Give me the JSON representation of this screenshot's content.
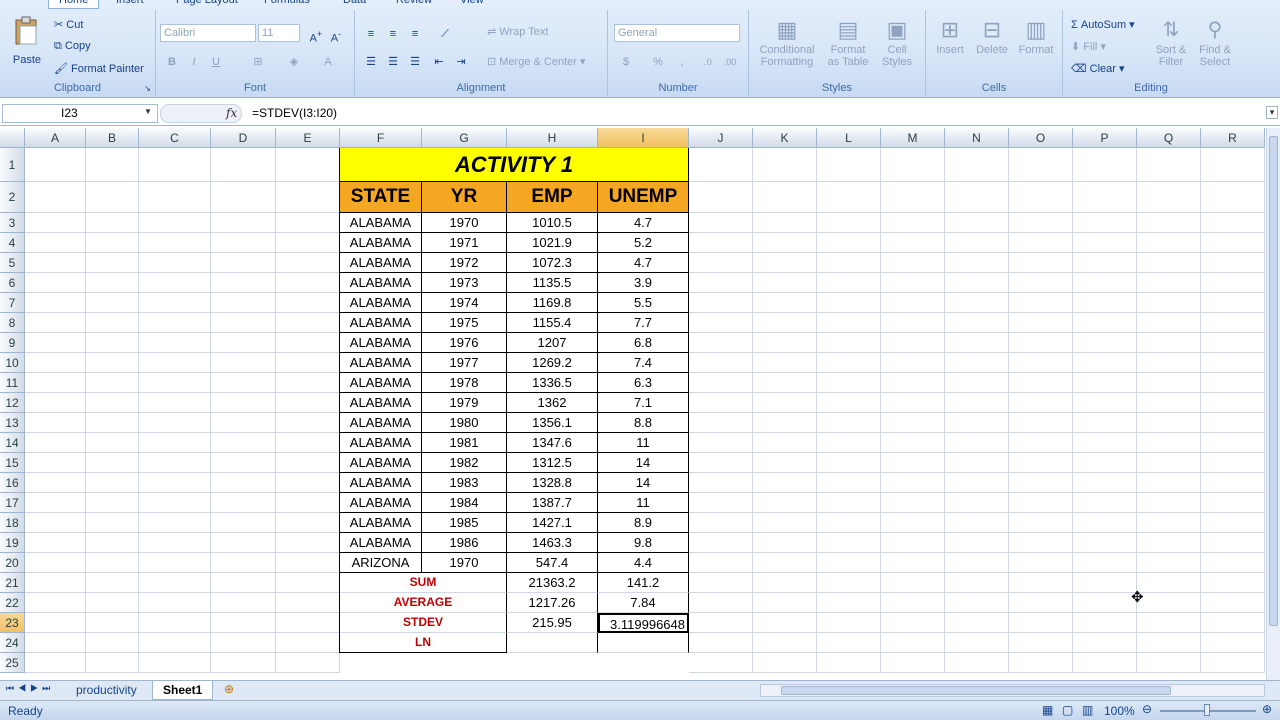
{
  "ribbon": {
    "tabs": [
      "Home",
      "Insert",
      "Page Layout",
      "Formulas",
      "Data",
      "Review",
      "View"
    ],
    "clipboard": {
      "label": "Clipboard",
      "paste": "Paste",
      "cut": "Cut",
      "copy": "Copy",
      "format_painter": "Format Painter"
    },
    "font": {
      "label": "Font",
      "font_name": "Calibri",
      "font_size": "11"
    },
    "alignment": {
      "label": "Alignment",
      "wrap_text": "Wrap Text",
      "merge_center": "Merge & Center"
    },
    "number": {
      "label": "Number",
      "format": "General"
    },
    "styles": {
      "label": "Styles",
      "conditional_1": "Conditional",
      "conditional_2": "Formatting",
      "format_table_1": "Format",
      "format_table_2": "as Table",
      "cell_styles_1": "Cell",
      "cell_styles_2": "Styles"
    },
    "cells": {
      "label": "Cells",
      "insert": "Insert",
      "delete": "Delete",
      "format": "Format"
    },
    "editing": {
      "label": "Editing",
      "autosum": "AutoSum",
      "fill": "Fill",
      "clear": "Clear",
      "sort_1": "Sort &",
      "sort_2": "Filter",
      "find_1": "Find &",
      "find_2": "Select"
    }
  },
  "formula_bar": {
    "name_box": "I23",
    "fx": "fx",
    "formula": "=STDEV(I3:I20)"
  },
  "columns": [
    "A",
    "B",
    "C",
    "D",
    "E",
    "F",
    "G",
    "H",
    "I",
    "J",
    "K",
    "L",
    "M",
    "N",
    "O",
    "P",
    "Q",
    "R"
  ],
  "rows": [
    "1",
    "2",
    "3",
    "4",
    "5",
    "6",
    "7",
    "8",
    "9",
    "10",
    "11",
    "12",
    "13",
    "14",
    "15",
    "16",
    "17",
    "18",
    "19",
    "20",
    "21",
    "22",
    "23",
    "24",
    "25"
  ],
  "table": {
    "title": "ACTIVITY 1",
    "headers": [
      "STATE",
      "YR",
      "EMP",
      "UNEMP"
    ],
    "data": [
      [
        "ALABAMA",
        "1970",
        "1010.5",
        "4.7"
      ],
      [
        "ALABAMA",
        "1971",
        "1021.9",
        "5.2"
      ],
      [
        "ALABAMA",
        "1972",
        "1072.3",
        "4.7"
      ],
      [
        "ALABAMA",
        "1973",
        "1135.5",
        "3.9"
      ],
      [
        "ALABAMA",
        "1974",
        "1169.8",
        "5.5"
      ],
      [
        "ALABAMA",
        "1975",
        "1155.4",
        "7.7"
      ],
      [
        "ALABAMA",
        "1976",
        "1207",
        "6.8"
      ],
      [
        "ALABAMA",
        "1977",
        "1269.2",
        "7.4"
      ],
      [
        "ALABAMA",
        "1978",
        "1336.5",
        "6.3"
      ],
      [
        "ALABAMA",
        "1979",
        "1362",
        "7.1"
      ],
      [
        "ALABAMA",
        "1980",
        "1356.1",
        "8.8"
      ],
      [
        "ALABAMA",
        "1981",
        "1347.6",
        "11"
      ],
      [
        "ALABAMA",
        "1982",
        "1312.5",
        "14"
      ],
      [
        "ALABAMA",
        "1983",
        "1328.8",
        "14"
      ],
      [
        "ALABAMA",
        "1984",
        "1387.7",
        "11"
      ],
      [
        "ALABAMA",
        "1985",
        "1427.1",
        "8.9"
      ],
      [
        "ALABAMA",
        "1986",
        "1463.3",
        "9.8"
      ],
      [
        "ARIZONA",
        "1970",
        "547.4",
        "4.4"
      ]
    ],
    "summary": [
      {
        "label": "SUM",
        "emp": "21363.2",
        "unemp": "141.2"
      },
      {
        "label": "AVERAGE",
        "emp": "1217.26",
        "unemp": "7.84"
      },
      {
        "label": "STDEV",
        "emp": "215.95",
        "unemp": "3.119996648"
      },
      {
        "label": "LN",
        "emp": "",
        "unemp": ""
      }
    ]
  },
  "sheets": [
    "productivity",
    "Sheet1"
  ],
  "status": {
    "ready": "Ready",
    "zoom": "100%"
  }
}
